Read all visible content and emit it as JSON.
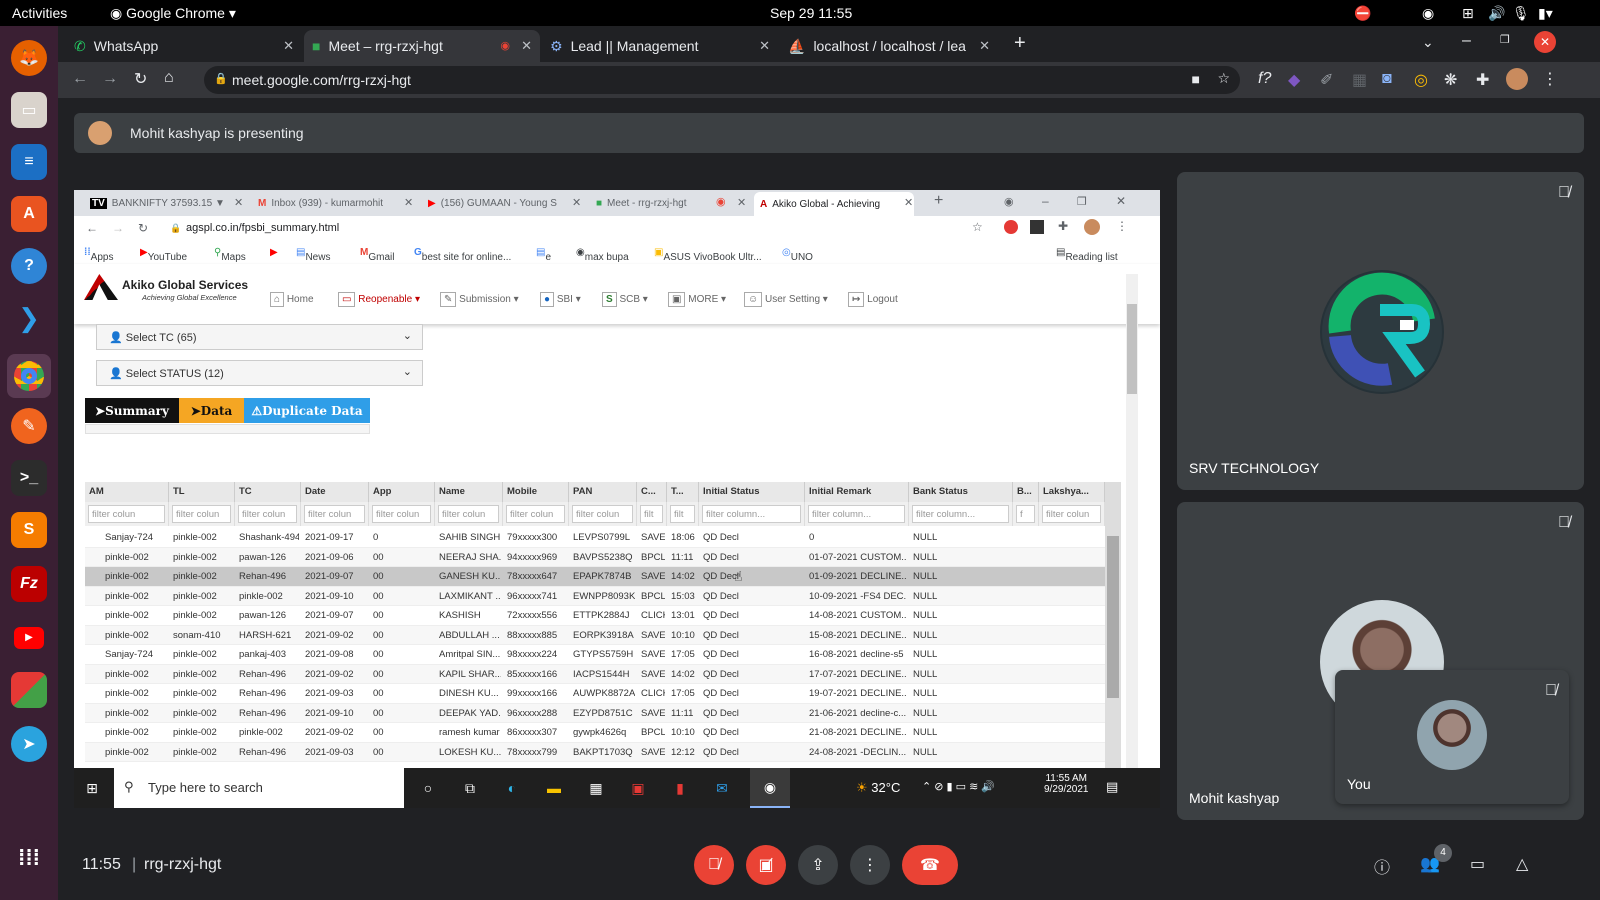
{
  "system_bar": {
    "activities": "Activities",
    "app": "Google Chrome",
    "datetime": "Sep 29  11:55"
  },
  "chrome_tabs": [
    {
      "label": "WhatsApp"
    },
    {
      "label": "Meet – rrg-rzxj-hgt"
    },
    {
      "label": "Lead || Management"
    },
    {
      "label": "localhost / localhost / lea"
    }
  ],
  "address": {
    "url": "meet.google.com/rrg-rzxj-hgt"
  },
  "presenting_bar": {
    "text": "Mohit kashyap is presenting"
  },
  "shared_screen": {
    "tabs": [
      {
        "label": "BANKNIFTY 37593.15 ▼"
      },
      {
        "label": "Inbox (939) - kumarmohit"
      },
      {
        "label": "(156) GUMAAN - Young S"
      },
      {
        "label": "Meet - rrg-rzxj-hgt"
      },
      {
        "label": "Akiko Global - Achieving"
      }
    ],
    "url": "agspl.co.in/fpsbi_summary.html",
    "bookmarks": [
      "Apps",
      "YouTube",
      "Maps",
      "News",
      "Gmail",
      "best site for online...",
      "e",
      "max bupa",
      "ASUS VivoBook Ultr...",
      "UNO",
      "Reading list"
    ],
    "logo_name": "Akiko Global Services",
    "logo_tagline": "Achieving Global Excellence",
    "nav": [
      "Home",
      "Reopenable",
      "Submission",
      "SBI",
      "SCB",
      "MORE",
      "User Setting",
      "Logout"
    ],
    "select_tc": "Select TC  (65)",
    "select_status": "Select STATUS  (12)",
    "buttons": {
      "summary": "Summary",
      "data": "Data",
      "duplicate": "Duplicate Data"
    },
    "columns": [
      "AM",
      "TL",
      "TC",
      "Date",
      "App",
      "Name",
      "Mobile",
      "PAN",
      "C...",
      "T...",
      "Initial Status",
      "Initial Remark",
      "Bank Status",
      "B...",
      "Lakshya..."
    ],
    "filters": [
      "filter colun",
      "filter colun",
      "filter colun",
      "filter colun",
      "filter colun",
      "filter colun",
      "filter colun",
      "filter colun",
      "filt",
      "filt",
      "filter column...",
      "filter column...",
      "filter column...",
      "f",
      "filter colun"
    ],
    "rows": [
      [
        "Sanjay-724",
        "pinkle-002",
        "Shashank-494",
        "2021-09-17",
        "0",
        "SAHIB SINGH",
        "79xxxxx300",
        "LEVPS0799L",
        "SAVE",
        "18:06",
        "QD Decl",
        "0",
        "NULL",
        "",
        ""
      ],
      [
        "pinkle-002",
        "pinkle-002",
        "pawan-126",
        "2021-09-06",
        "00",
        "NEERAJ SHA...",
        "94xxxxx969",
        "BAVPS5238Q",
        "BPCL",
        "11:11",
        "QD Decl",
        "01-07-2021 CUSTOM...",
        "NULL",
        "",
        ""
      ],
      [
        "pinkle-002",
        "pinkle-002",
        "Rehan-496",
        "2021-09-07",
        "00",
        "GANESH KU...",
        "78xxxxx647",
        "EPAPK7874B",
        "SAVE",
        "14:02",
        "QD Decl",
        "01-09-2021 DECLINE...",
        "NULL",
        "",
        ""
      ],
      [
        "pinkle-002",
        "pinkle-002",
        "pinkle-002",
        "2021-09-10",
        "00",
        "LAXMIKANT ...",
        "96xxxxx741",
        "EWNPP8093K",
        "BPCL",
        "15:03",
        "QD Decl",
        "10-09-2021 -FS4 DEC...",
        "NULL",
        "",
        ""
      ],
      [
        "pinkle-002",
        "pinkle-002",
        "pawan-126",
        "2021-09-07",
        "00",
        "KASHISH",
        "72xxxxx556",
        "ETTPK2884J",
        "CLICK",
        "13:01",
        "QD Decl",
        "14-08-2021 CUSTOM...",
        "NULL",
        "",
        ""
      ],
      [
        "pinkle-002",
        "sonam-410",
        "HARSH-621",
        "2021-09-02",
        "00",
        "ABDULLAH ...",
        "88xxxxx885",
        "EORPK3918A",
        "SAVE",
        "10:10",
        "QD Decl",
        "15-08-2021 DECLINE...",
        "NULL",
        "",
        ""
      ],
      [
        "Sanjay-724",
        "pinkle-002",
        "pankaj-403",
        "2021-09-08",
        "00",
        "Amritpal SIN...",
        "98xxxxx224",
        "GTYPS5759H",
        "SAVE",
        "17:05",
        "QD Decl",
        "16-08-2021 decline-s5",
        "NULL",
        "",
        ""
      ],
      [
        "pinkle-002",
        "pinkle-002",
        "Rehan-496",
        "2021-09-02",
        "00",
        "KAPIL SHAR...",
        "85xxxxx166",
        "IACPS1544H",
        "SAVE",
        "14:02",
        "QD Decl",
        "17-07-2021 DECLINE...",
        "NULL",
        "",
        ""
      ],
      [
        "pinkle-002",
        "pinkle-002",
        "Rehan-496",
        "2021-09-03",
        "00",
        "DINESH KU...",
        "99xxxxx166",
        "AUWPK8872A",
        "CLICK",
        "17:05",
        "QD Decl",
        "19-07-2021 DECLINE...",
        "NULL",
        "",
        ""
      ],
      [
        "pinkle-002",
        "pinkle-002",
        "Rehan-496",
        "2021-09-10",
        "00",
        "DEEPAK YAD...",
        "96xxxxx288",
        "EZYPD8751C",
        "SAVE",
        "11:11",
        "QD Decl",
        "21-06-2021 decline-c...",
        "NULL",
        "",
        ""
      ],
      [
        "pinkle-002",
        "pinkle-002",
        "pinkle-002",
        "2021-09-02",
        "00",
        "ramesh kumar",
        "86xxxxx307",
        "gywpk4626q",
        "BPCL",
        "10:10",
        "QD Decl",
        "21-08-2021 DECLINE...",
        "NULL",
        "",
        ""
      ],
      [
        "pinkle-002",
        "pinkle-002",
        "Rehan-496",
        "2021-09-03",
        "00",
        "LOKESH KU...",
        "78xxxxx799",
        "BAKPT1703Q",
        "SAVE",
        "12:12",
        "QD Decl",
        "24-08-2021 -DECLIN...",
        "NULL",
        "",
        ""
      ]
    ],
    "taskbar": {
      "search": "Type here to search",
      "weather": "32°C",
      "time": "11:55 AM",
      "date": "9/29/2021"
    }
  },
  "participants": {
    "srv_name": "SRV TECHNOLOGY",
    "mohit_name": "Mohit kashyap",
    "you_name": "You",
    "people_count": "4"
  },
  "meeting": {
    "time": "11:55",
    "separator": "|",
    "code": "rrg-rzxj-hgt"
  },
  "colors": {
    "end_call": "#ea4335",
    "brand_red": "#c00000",
    "summary_btn": "#111111",
    "data_btn": "#f5a623",
    "duplicate_btn": "#2f9ee8"
  }
}
